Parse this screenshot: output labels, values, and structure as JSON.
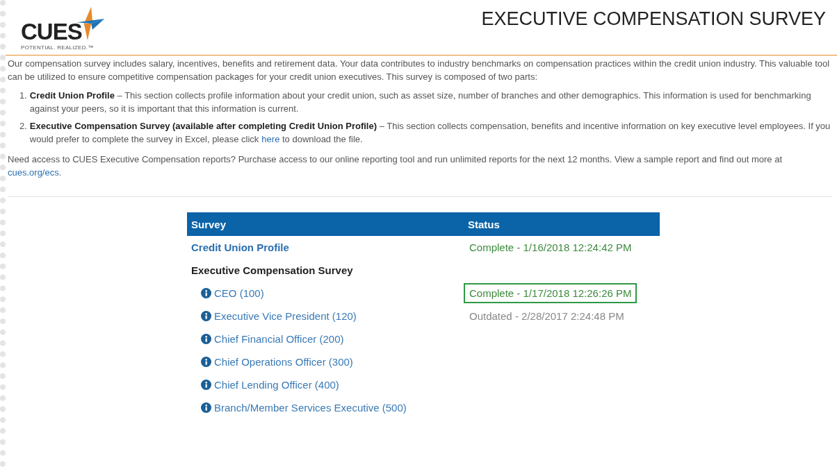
{
  "logo": {
    "wordmark": "CUES",
    "tagline": "POTENTIAL. REALIZED.™"
  },
  "page_title": "EXECUTIVE COMPENSATION SURVEY",
  "intro": "Our compensation survey includes salary, incentives, benefits and retirement data. Your data contributes to industry benchmarks on compensation practices within the credit union industry. This valuable tool can be utilized to ensure competitive compensation packages for your credit union executives. This survey is composed of two parts:",
  "parts": [
    {
      "number": "1.",
      "text_before": "**Credit Union Profile** – This section collects profile information about your credit union, such as asset size, number of branches and other demographics. This information is used for benchmarking against your peers, so it is important that this information is current."
    },
    {
      "number": "2.",
      "text_before": "**Executive Compensation Survey (available after completing Credit Union Profile)** – This section collects compensation, benefits and incentive information on key executive level employees.  If you would prefer to complete the survey in Excel, please click",
      "link": "here",
      "text_after": "to download the file."
    }
  ],
  "reports": {
    "text_before": "Need access to CUES Executive Compensation reports?  Purchase access to our online reporting tool and run unlimited reports for the next 12 months.  View a sample report and find out more at",
    "link": "cues.org/ecs",
    "text_after": "."
  },
  "table": {
    "columns": [
      "Survey",
      "Status"
    ],
    "rows": [
      {
        "kind": "section",
        "label": "Credit Union Profile",
        "status": "Complete - 1/16/2018 12:24:42 PM",
        "outdated": false,
        "highlighted": false
      },
      {
        "kind": "group",
        "label": "Executive Compensation Survey"
      },
      {
        "kind": "position",
        "label": "CEO (100)",
        "status": "Complete - 1/17/2018 12:26:26 PM",
        "outdated": false,
        "highlighted": true
      },
      {
        "kind": "position",
        "label": "Executive Vice President (120)",
        "status": "Outdated - 2/28/2017 2:24:48 PM",
        "outdated": true,
        "highlighted": false
      },
      {
        "kind": "position",
        "label": "Chief Financial Officer (200)"
      },
      {
        "kind": "position",
        "label": "Chief Operations Officer (300)"
      },
      {
        "kind": "position",
        "label": "Chief Lending Officer (400)"
      },
      {
        "kind": "position",
        "label": "Branch/Member Services Executive (500)"
      }
    ]
  }
}
